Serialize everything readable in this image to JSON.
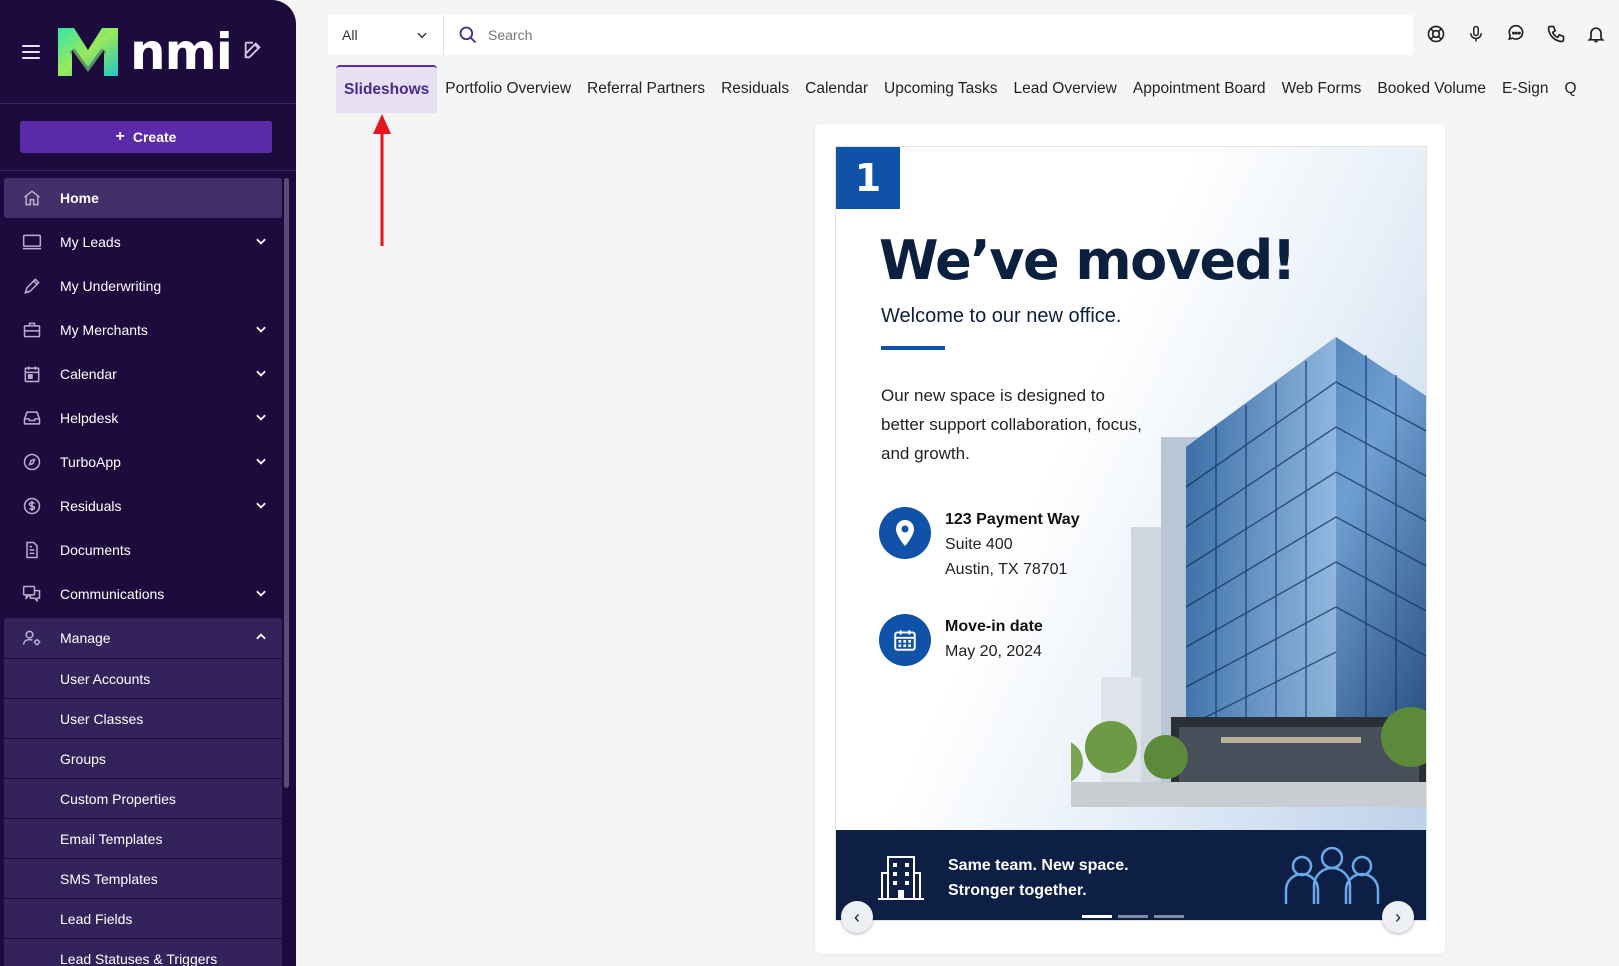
{
  "brand": {
    "name": "nmi"
  },
  "sidebar": {
    "create_label": "Create",
    "items": [
      {
        "label": "Home",
        "icon": "home-icon",
        "active": true
      },
      {
        "label": "My Leads",
        "icon": "monitor-icon",
        "chevron": "down"
      },
      {
        "label": "My Underwriting",
        "icon": "pen-icon"
      },
      {
        "label": "My Merchants",
        "icon": "briefcase-icon",
        "chevron": "down"
      },
      {
        "label": "Calendar",
        "icon": "calendar-icon",
        "chevron": "down"
      },
      {
        "label": "Helpdesk",
        "icon": "inbox-icon",
        "chevron": "down"
      },
      {
        "label": "TurboApp",
        "icon": "compass-icon",
        "chevron": "down"
      },
      {
        "label": "Residuals",
        "icon": "dollar-icon",
        "chevron": "down"
      },
      {
        "label": "Documents",
        "icon": "document-icon"
      },
      {
        "label": "Communications",
        "icon": "chat-icon",
        "chevron": "down"
      },
      {
        "label": "Manage",
        "icon": "user-gear-icon",
        "chevron": "up"
      }
    ],
    "manage_items": [
      "User Accounts",
      "User Classes",
      "Groups",
      "Custom Properties",
      "Email Templates",
      "SMS Templates",
      "Lead Fields",
      "Lead Statuses & Triggers"
    ]
  },
  "topbar": {
    "scope_value": "All",
    "search_placeholder": "Search",
    "icons": [
      "support-icon",
      "microphone-icon",
      "chat-bubble-icon",
      "phone-icon",
      "bell-icon"
    ]
  },
  "tabs": [
    "Slideshows",
    "Portfolio Overview",
    "Referral Partners",
    "Residuals",
    "Calendar",
    "Upcoming Tasks",
    "Lead Overview",
    "Appointment Board",
    "Web Forms",
    "Booked Volume",
    "E-Sign",
    "Q"
  ],
  "active_tab": "Slideshows",
  "slide": {
    "number": "1",
    "headline": "We’ve moved!",
    "subhead": "Welcome to our new office.",
    "body": "Our new space is designed to better support collaboration, focus, and growth.",
    "address": {
      "line1": "123 Payment Way",
      "line2": "Suite 400",
      "line3": "Austin, TX 78701"
    },
    "move_in": {
      "label": "Move-in date",
      "date": "May 20, 2024"
    },
    "footer": {
      "line1": "Same team. New space.",
      "line2": "Stronger together."
    },
    "prev_arrow": "‹",
    "next_arrow": "›",
    "total_slides": 3,
    "current_slide": 1
  },
  "colors": {
    "sidebar_bg": "#1e0b3d",
    "accent": "#5b2aa8",
    "slide_blue": "#0f52a8",
    "annotation_red": "#e8141b"
  }
}
